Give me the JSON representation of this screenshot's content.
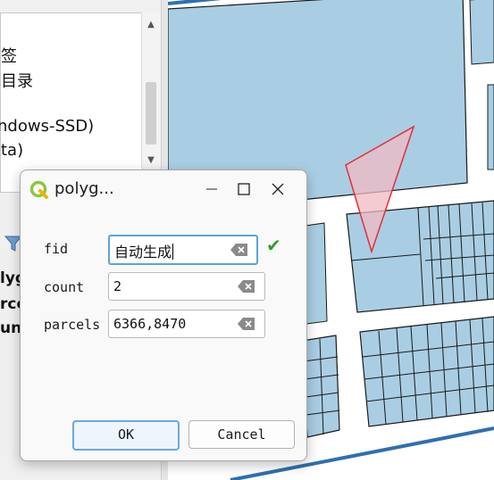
{
  "browser": {
    "tree_items": [
      "签",
      "目录",
      "ndows-SSD)",
      "ta)"
    ],
    "layer_items": [
      "lyg",
      "rce",
      "un"
    ]
  },
  "dialog": {
    "title": "polyg...",
    "fields": [
      {
        "label": "fid",
        "value": "自动生成"
      },
      {
        "label": "count",
        "value": "2"
      },
      {
        "label": "parcels",
        "value": "6366,8470"
      }
    ],
    "ok_label": "OK",
    "cancel_label": "Cancel"
  },
  "colors": {
    "parcel_fill": "#a9cee3",
    "parcel_stroke": "#1a1a1a",
    "road_line": "#2f6fb0",
    "selection_stroke": "#e0303a",
    "selection_fill": "#f1b9c3",
    "valid_check": "#2e9c2e"
  }
}
